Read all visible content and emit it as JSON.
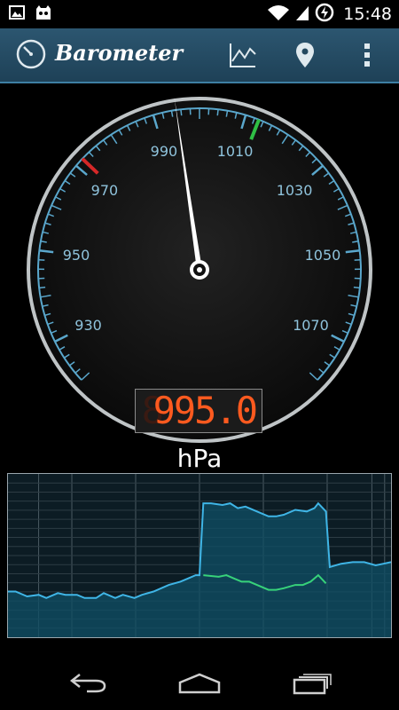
{
  "status_bar": {
    "time": "15:48"
  },
  "action_bar": {
    "title": "Barometer",
    "icons": [
      "barometer-app-icon",
      "chart-icon",
      "location-pin-icon",
      "overflow-menu-icon"
    ]
  },
  "gauge": {
    "tick_labels": [
      "930",
      "950",
      "970",
      "990",
      "1010",
      "1030",
      "1050",
      "1070"
    ],
    "range": [
      920,
      1080
    ],
    "needle_value": 995.0,
    "low_marker_value": 972,
    "high_marker_value": 1013,
    "reading": "995.0",
    "ghost_digit": "8",
    "unit": "hPa",
    "colors": {
      "ring": "#5aa7cc",
      "needle": "#ffffff",
      "lcd": "#ff5a1f",
      "low": "#d62828",
      "high": "#2fbf45"
    }
  },
  "graph": {
    "colors": {
      "pressure": "#3fb5e6",
      "secondary": "#37d27a",
      "fill": "#0f4f66"
    },
    "pressure_series": [
      [
        0,
        0.72
      ],
      [
        0.02,
        0.72
      ],
      [
        0.05,
        0.75
      ],
      [
        0.08,
        0.74
      ],
      [
        0.1,
        0.76
      ],
      [
        0.13,
        0.73
      ],
      [
        0.15,
        0.74
      ],
      [
        0.18,
        0.74
      ],
      [
        0.2,
        0.76
      ],
      [
        0.23,
        0.76
      ],
      [
        0.25,
        0.73
      ],
      [
        0.28,
        0.76
      ],
      [
        0.3,
        0.74
      ],
      [
        0.33,
        0.76
      ],
      [
        0.35,
        0.74
      ],
      [
        0.38,
        0.72
      ],
      [
        0.4,
        0.7
      ],
      [
        0.42,
        0.68
      ],
      [
        0.45,
        0.66
      ],
      [
        0.47,
        0.64
      ],
      [
        0.49,
        0.62
      ],
      [
        0.5,
        0.62
      ],
      [
        0.51,
        0.18
      ],
      [
        0.53,
        0.18
      ],
      [
        0.56,
        0.19
      ],
      [
        0.58,
        0.18
      ],
      [
        0.6,
        0.21
      ],
      [
        0.62,
        0.2
      ],
      [
        0.65,
        0.23
      ],
      [
        0.68,
        0.26
      ],
      [
        0.7,
        0.26
      ],
      [
        0.72,
        0.25
      ],
      [
        0.75,
        0.22
      ],
      [
        0.78,
        0.23
      ],
      [
        0.8,
        0.21
      ],
      [
        0.81,
        0.18
      ],
      [
        0.83,
        0.23
      ],
      [
        0.84,
        0.57
      ],
      [
        0.87,
        0.55
      ],
      [
        0.9,
        0.54
      ],
      [
        0.93,
        0.54
      ],
      [
        0.96,
        0.56
      ],
      [
        0.98,
        0.55
      ],
      [
        1.0,
        0.54
      ]
    ],
    "secondary_series": [
      [
        0.51,
        0.62
      ],
      [
        0.55,
        0.63
      ],
      [
        0.57,
        0.62
      ],
      [
        0.59,
        0.64
      ],
      [
        0.61,
        0.66
      ],
      [
        0.63,
        0.66
      ],
      [
        0.65,
        0.68
      ],
      [
        0.68,
        0.71
      ],
      [
        0.7,
        0.71
      ],
      [
        0.72,
        0.7
      ],
      [
        0.75,
        0.68
      ],
      [
        0.77,
        0.68
      ],
      [
        0.79,
        0.66
      ],
      [
        0.81,
        0.62
      ],
      [
        0.83,
        0.67
      ]
    ]
  },
  "nav_bar": {
    "icons": [
      "back-icon",
      "home-icon",
      "recent-apps-icon"
    ]
  }
}
